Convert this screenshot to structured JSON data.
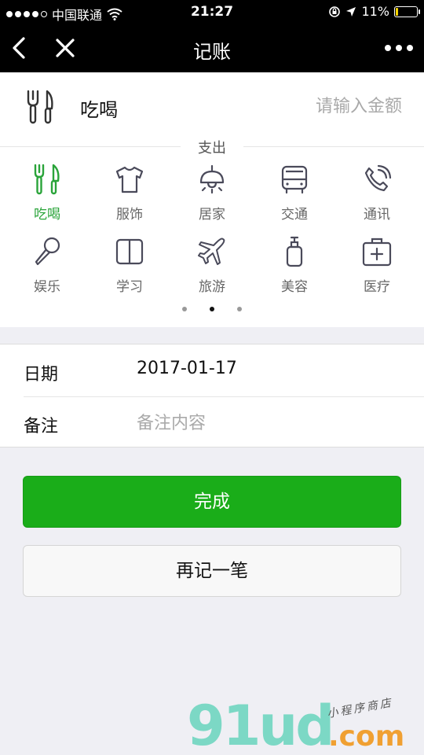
{
  "status_bar": {
    "carrier": "中国联通",
    "time": "21:27",
    "battery": "11%",
    "battery_level": 0.11
  },
  "navbar": {
    "title": "记账",
    "back_icon": "chevron-left-icon",
    "close_icon": "close-icon",
    "more_icon": "more-dots-icon"
  },
  "amount": {
    "category_name": "吃喝",
    "placeholder": "请输入金额",
    "value": ""
  },
  "categories": {
    "section_label": "支出",
    "active_color": "#2aa43a",
    "items": [
      {
        "label": "吃喝",
        "icon": "fork-knife-icon",
        "active": true
      },
      {
        "label": "服饰",
        "icon": "tshirt-icon"
      },
      {
        "label": "居家",
        "icon": "lamp-icon"
      },
      {
        "label": "交通",
        "icon": "bus-icon"
      },
      {
        "label": "通讯",
        "icon": "phone-icon"
      },
      {
        "label": "娱乐",
        "icon": "microphone-icon"
      },
      {
        "label": "学习",
        "icon": "book-icon"
      },
      {
        "label": "旅游",
        "icon": "airplane-icon"
      },
      {
        "label": "美容",
        "icon": "bottle-icon"
      },
      {
        "label": "医疗",
        "icon": "medical-kit-icon"
      }
    ],
    "pager": {
      "pages": 3,
      "current": 2
    }
  },
  "form": {
    "date_label": "日期",
    "date_value": "2017-01-17",
    "remark_label": "备注",
    "remark_placeholder": "备注内容",
    "remark_value": ""
  },
  "buttons": {
    "done_label": "完成",
    "done_color": "#1aad19",
    "again_label": "再记一笔"
  },
  "watermark": {
    "brand": "91ud",
    "domain": ".com",
    "tagline": "小程序商店"
  }
}
